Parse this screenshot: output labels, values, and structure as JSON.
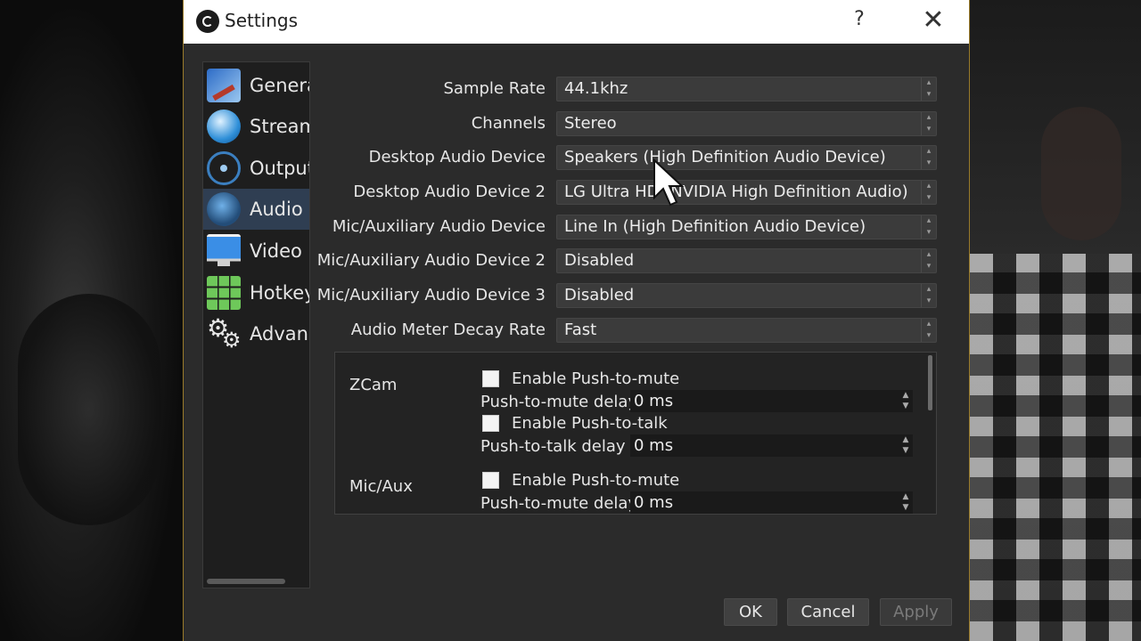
{
  "window": {
    "title": "Settings",
    "help": "?",
    "close": "✕"
  },
  "sidebar": {
    "items": [
      {
        "label": "General",
        "icon": "general-icon",
        "active": false
      },
      {
        "label": "Stream",
        "icon": "stream-icon",
        "active": false
      },
      {
        "label": "Output",
        "icon": "output-icon",
        "active": false
      },
      {
        "label": "Audio",
        "icon": "audio-icon",
        "active": true
      },
      {
        "label": "Video",
        "icon": "video-icon",
        "active": false
      },
      {
        "label": "Hotkeys",
        "icon": "hotkeys-icon",
        "active": false
      },
      {
        "label": "Advanced",
        "icon": "advanced-icon",
        "active": false
      }
    ]
  },
  "audio": {
    "fields": [
      {
        "label": "Sample Rate",
        "value": "44.1khz"
      },
      {
        "label": "Channels",
        "value": "Stereo"
      },
      {
        "label": "Desktop Audio Device",
        "value": "Speakers (High Definition Audio Device)"
      },
      {
        "label": "Desktop Audio Device 2",
        "value": "LG Ultra HD (NVIDIA High Definition Audio)"
      },
      {
        "label": "Mic/Auxiliary Audio Device",
        "value": "Line In (High Definition Audio Device)"
      },
      {
        "label": "Mic/Auxiliary Audio Device 2",
        "value": "Disabled"
      },
      {
        "label": "Mic/Auxiliary Audio Device 3",
        "value": "Disabled"
      },
      {
        "label": "Audio Meter Decay Rate",
        "value": "Fast"
      }
    ]
  },
  "hotkeys_panel": {
    "sources": [
      {
        "name": "ZCam",
        "push_to_mute_label": "Enable Push-to-mute",
        "push_to_mute_checked": false,
        "push_to_mute_delay_label": "Push-to-mute delay",
        "push_to_mute_delay": "0 ms",
        "push_to_talk_label": "Enable Push-to-talk",
        "push_to_talk_checked": false,
        "push_to_talk_delay_label": "Push-to-talk delay",
        "push_to_talk_delay": "0 ms"
      },
      {
        "name": "Mic/Aux",
        "push_to_mute_label": "Enable Push-to-mute",
        "push_to_mute_checked": false,
        "push_to_mute_delay_label": "Push-to-mute delay",
        "push_to_mute_delay": "0 ms"
      }
    ]
  },
  "buttons": {
    "ok": "OK",
    "cancel": "Cancel",
    "apply": "Apply",
    "apply_enabled": false
  },
  "colors": {
    "accent_border": "#9a7b2a",
    "active_nav": "#2f3e52",
    "window_bg": "#2b2b2b"
  }
}
